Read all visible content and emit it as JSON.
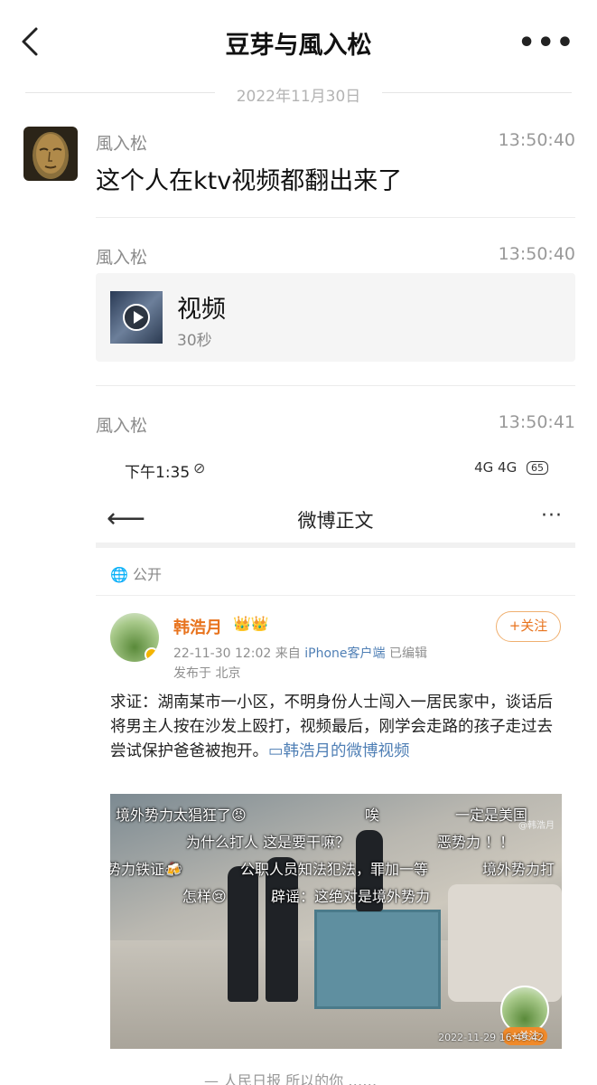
{
  "header": {
    "title": "豆芽与風入松",
    "more": "•••"
  },
  "date_divider": "2022年11月30日",
  "messages": [
    {
      "sender": "風入松",
      "time": "13:50:40",
      "text": "这个人在ktv视频都翻出来了"
    },
    {
      "sender": "風入松",
      "time": "13:50:40",
      "video": {
        "title": "视频",
        "duration": "30秒"
      }
    },
    {
      "sender": "風入松",
      "time": "13:50:41"
    }
  ],
  "screenshot": {
    "status": {
      "time": "下午1:35",
      "mute": "⊘",
      "network": "4G 4G",
      "battery": "65"
    },
    "nav": {
      "back": "⟵",
      "title": "微博正文",
      "more": "···"
    },
    "visibility": "公开",
    "post": {
      "author": "韩浩月",
      "badges": "👑👑",
      "date": "22-11-30 12:02",
      "source_prefix": "来自",
      "source": "iPhone客户端",
      "edited": "已编辑",
      "location": "发布于 北京",
      "follow": "+关注",
      "body": "求证：湖南某市一小区，不明身份人士闯入一居民家中，谈话后将男主人按在沙发上殴打，视频最后，刚学会走路的孩子走过去尝试保护爸爸被抱开。",
      "link": "▭韩浩月的微博视频",
      "video": {
        "danmaku": [
          "境外势力太猖狂了😡",
          "唉",
          "一定是美国",
          "为什么打人  这是要干嘛？",
          "恶势力 ！！",
          "势力铁证🍻",
          "公职人员知法犯法，罪加一等",
          "境外势力打",
          "怎样😢",
          "辟谣：这绝对是境外势力"
        ],
        "watermark": "@韩浩月",
        "timestamp": "2022-11-29  16:49:42",
        "mini_follow": "+关注"
      }
    },
    "cut_text": "— 人民日报  所以的你 ……"
  }
}
